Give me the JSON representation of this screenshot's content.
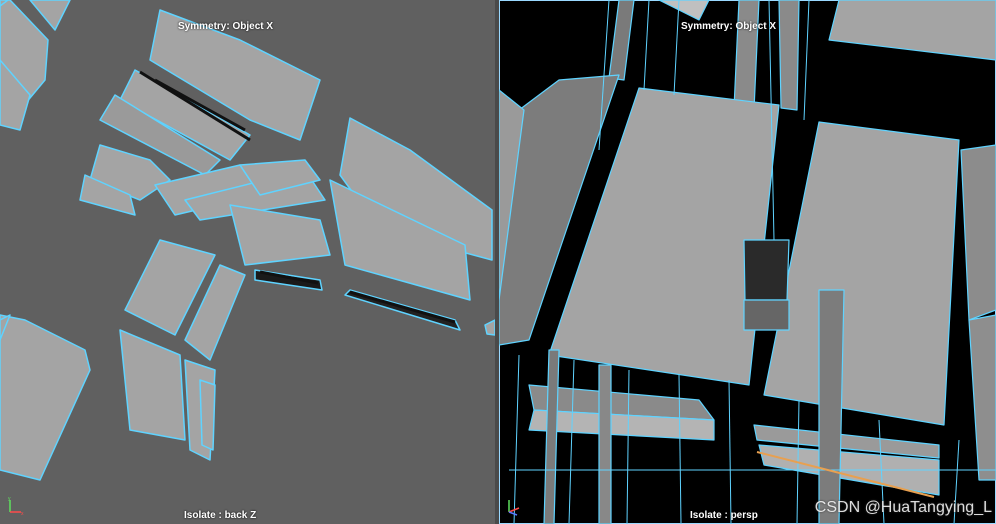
{
  "viewports": {
    "left": {
      "symmetry_label": "Symmetry: Object X",
      "isolate_label": "Isolate : back Z"
    },
    "right": {
      "symmetry_label": "Symmetry: Object X",
      "isolate_label": "Isolate : persp"
    }
  },
  "watermark": "CSDN @HuaTangying_L",
  "colors": {
    "background_left": "#606060",
    "mesh_face": "#a4a4a4",
    "wire_highlight": "#5fd3ff",
    "background_right": "#000000"
  },
  "icons": {
    "axis_gizmo": "axis-gizmo-icon"
  }
}
